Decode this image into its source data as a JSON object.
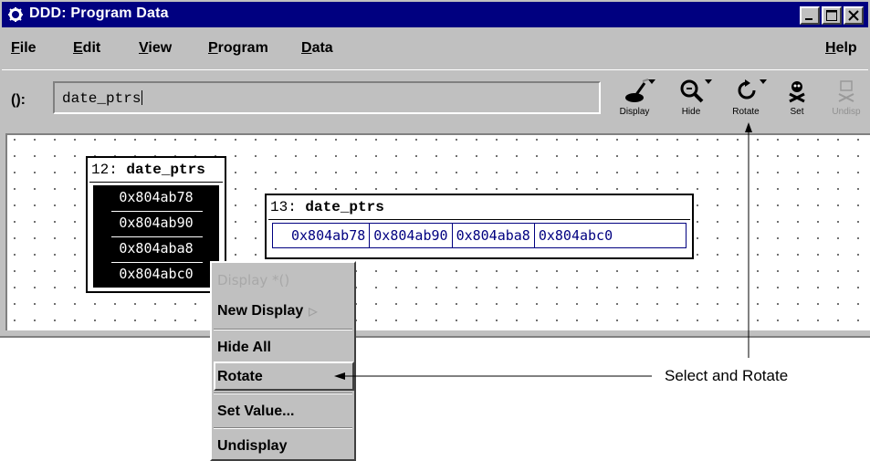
{
  "window": {
    "title": "DDD: Program Data",
    "buttons": [
      "minimize",
      "maximize",
      "close"
    ]
  },
  "menubar": {
    "items": [
      {
        "label": "File",
        "mnemonic": "F",
        "rest": "ile"
      },
      {
        "label": "Edit",
        "mnemonic": "E",
        "rest": "dit"
      },
      {
        "label": "View",
        "mnemonic": "V",
        "rest": "iew"
      },
      {
        "label": "Program",
        "mnemonic": "P",
        "rest": "rogram"
      },
      {
        "label": "Data",
        "mnemonic": "D",
        "rest": "ata"
      },
      {
        "label": "Help",
        "mnemonic": "H",
        "rest": "elp"
      }
    ]
  },
  "toolbar": {
    "arg_label": "():",
    "arg_value": "date_ptrs",
    "tools": [
      {
        "label": "Display",
        "icon": "display-icon"
      },
      {
        "label": "Hide",
        "icon": "hide-icon"
      },
      {
        "label": "Rotate",
        "icon": "rotate-icon"
      },
      {
        "label": "Set",
        "icon": "set-icon"
      },
      {
        "label": "Undisp",
        "icon": "undisplay-icon"
      }
    ]
  },
  "displays": [
    {
      "number": "12:",
      "name": "date_ptrs",
      "values": [
        "0x804ab78",
        "0x804ab90",
        "0x804aba8",
        "0x804abc0"
      ]
    },
    {
      "number": "13:",
      "name": "date_ptrs",
      "values": [
        "0x804ab78",
        "0x804ab90",
        "0x804aba8",
        "0x804abc0"
      ]
    }
  ],
  "popup_menu": {
    "items": [
      "Display *()",
      "New Display",
      "Hide All",
      "Rotate",
      "Set Value...",
      "Undisplay"
    ]
  },
  "annotation": {
    "text": "Select and Rotate"
  }
}
